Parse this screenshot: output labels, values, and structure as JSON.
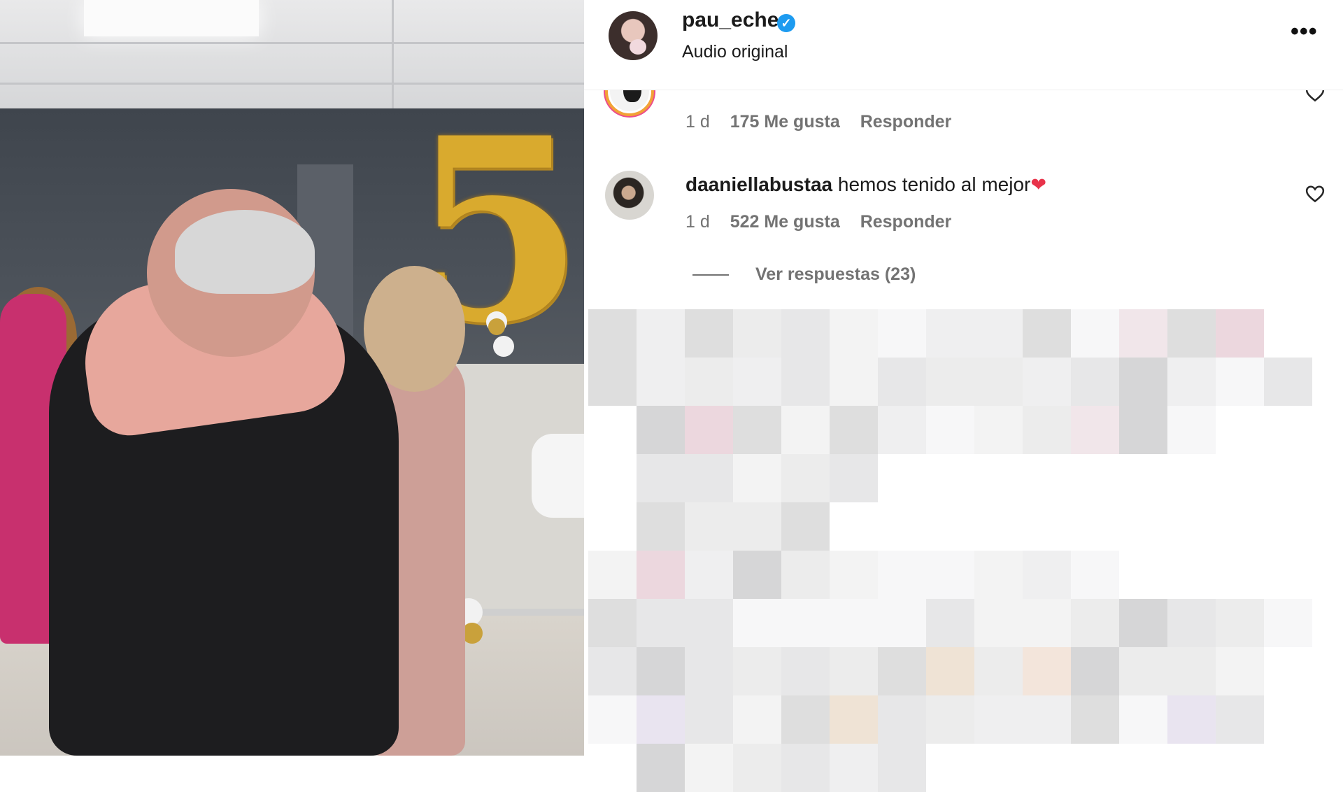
{
  "post": {
    "username": "pau_eche",
    "verified_icon": "verified-badge-icon",
    "audio_label": "Audio original",
    "more_icon": "more-options-icon",
    "more_glyph": "•••"
  },
  "comments": [
    {
      "username": "",
      "text": "",
      "time": "1 d",
      "likes": "175 Me gusta",
      "reply": "Responder",
      "like_icon": "heart-outline-icon"
    },
    {
      "username": "daaniellabustaa",
      "text": "hemos tenido al mejor",
      "emoji": "❤",
      "time": "1 d",
      "likes": "522 Me gusta",
      "reply": "Responder",
      "like_icon": "heart-outline-icon"
    }
  ],
  "view_replies": "Ver respuestas (23)",
  "video": {
    "balloon_number": "5"
  },
  "colors": {
    "verified": "#1d9bf0",
    "meta_text": "#737373",
    "heart_emoji": "#e8334a",
    "story_ring": "#ec4b8d"
  }
}
